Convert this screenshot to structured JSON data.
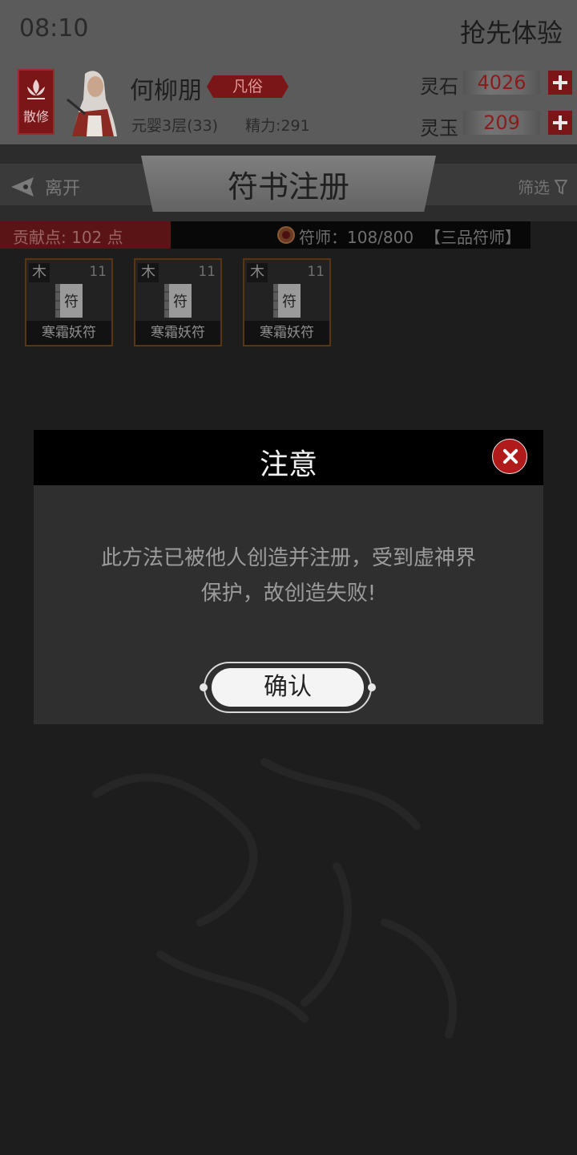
{
  "status_bar": {
    "time": "08:10",
    "early_access": "抢先体验"
  },
  "player": {
    "sect": "散修",
    "name": "何柳朋",
    "rank": "凡俗",
    "realm": "元婴3层(33)",
    "energy": "精力:291"
  },
  "resources": [
    {
      "label": "灵石",
      "value": "4026"
    },
    {
      "label": "灵玉",
      "value": "209"
    }
  ],
  "nav": {
    "leave": "离开",
    "title": "符书注册",
    "filter": "筛选"
  },
  "info_bar": {
    "contribution": "贡献点: 102 点",
    "master": "符师：108/800",
    "master_rank": "【三品符师】"
  },
  "cards": [
    {
      "element": "木",
      "level": "11",
      "glyph": "符",
      "name": "寒霜妖符"
    },
    {
      "element": "木",
      "level": "11",
      "glyph": "符",
      "name": "寒霜妖符"
    },
    {
      "element": "木",
      "level": "11",
      "glyph": "符",
      "name": "寒霜妖符"
    }
  ],
  "dialog": {
    "title": "注意",
    "message_line1": "此方法已被他人创造并注册，受到虚神界",
    "message_line2": "保护，故创造失败!",
    "confirm": "确认"
  },
  "colors": {
    "accent_red": "#7a1518",
    "close_red": "#b01a1a",
    "card_border": "#5a3610"
  }
}
